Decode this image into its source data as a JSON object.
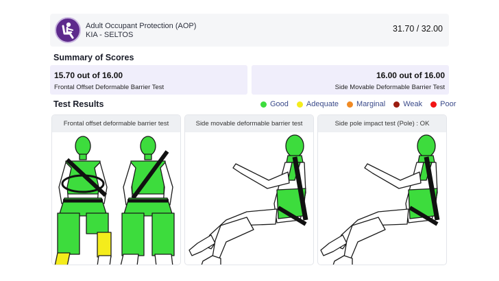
{
  "header": {
    "title": "Adult Occupant Protection (AOP)",
    "subtitle": "KIA - SELTOS",
    "total_score": "31.70 / 32.00",
    "logo_icon": "seated-occupant-icon"
  },
  "summary": {
    "heading": "Summary of Scores",
    "cards": [
      {
        "value": "15.70 out of 16.00",
        "label": "Frontal Offset Deformable Barrier Test"
      },
      {
        "value": "16.00 out of 16.00",
        "label": "Side Movable Deformable Barrier Test"
      }
    ]
  },
  "results": {
    "heading": "Test Results",
    "legend": [
      {
        "label": "Good",
        "color": "#3ddc3d"
      },
      {
        "label": "Adequate",
        "color": "#f4ec1c"
      },
      {
        "label": "Marginal",
        "color": "#f08a24"
      },
      {
        "label": "Weak",
        "color": "#9b1c10"
      },
      {
        "label": "Poor",
        "color": "#f21414"
      }
    ],
    "panels": [
      {
        "title": "Frontal offset deformable barrier test"
      },
      {
        "title": "Side movable deformable barrier test"
      },
      {
        "title": "Side pole impact test (Pole) : OK"
      }
    ]
  },
  "colors": {
    "good": "#3ddc3d",
    "adequate": "#f4ec1c",
    "accent": "#5d2a8c",
    "card_bg": "#f0eefb"
  }
}
